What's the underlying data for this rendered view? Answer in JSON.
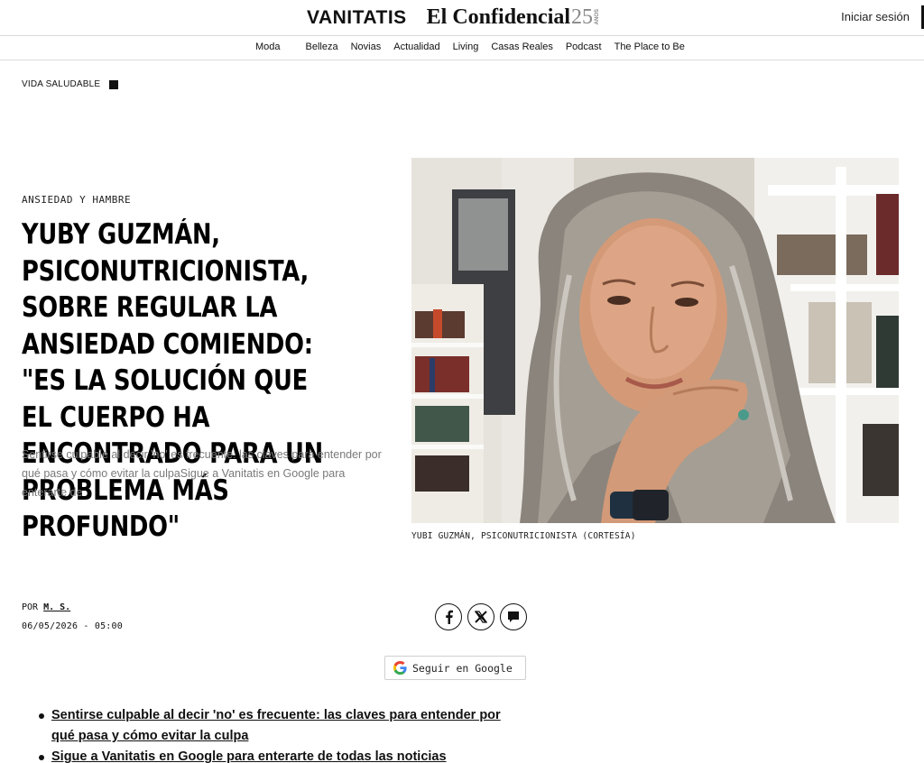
{
  "header": {
    "brand_primary": "VANITATIS",
    "brand_secondary": "El Confidencial",
    "brand_anniversary": "25",
    "brand_anniversary_small": "AÑOS",
    "login_label": "Iniciar sesión"
  },
  "nav": {
    "items": [
      "Moda",
      "Belleza",
      "Novias",
      "Actualidad",
      "Living",
      "Casas Reales",
      "Podcast",
      "The Place to Be"
    ]
  },
  "section": {
    "label": "VIDA SALUDABLE"
  },
  "article": {
    "kicker": "ANSIEDAD Y HAMBRE",
    "headline": "Yuby Guzmán, psiconutricionista, sobre regular la ansiedad comiendo: \"Es la solución que el cuerpo ha encontrado para un problema más profundo\"",
    "summary": "Sentirse culpable al decir 'no' es frecuente: las claves para entender por qué pasa y cómo evitar la culpaSigue a Vanitatis en Google para enterarte de",
    "image_caption": "YUBI GUZMÁN, PSICONUTRICIONISTA (CORTESÍA)",
    "byline_prefix": "POR",
    "author": "M. S.",
    "date": "06/05/2026 - 05:00",
    "follow_label": "Seguir en Google",
    "related": [
      "Sentirse culpable al decir 'no' es frecuente: las claves para entender por qué pasa y cómo evitar la culpa",
      "Sigue a Vanitatis en Google para enterarte de todas las noticias"
    ]
  },
  "icons": {
    "facebook": "facebook-icon",
    "x": "x-icon",
    "comments": "comment-icon",
    "google": "google-icon"
  },
  "colors": {
    "text": "#111111",
    "summary": "#7a7a7a",
    "border": "#d9d9d9"
  }
}
